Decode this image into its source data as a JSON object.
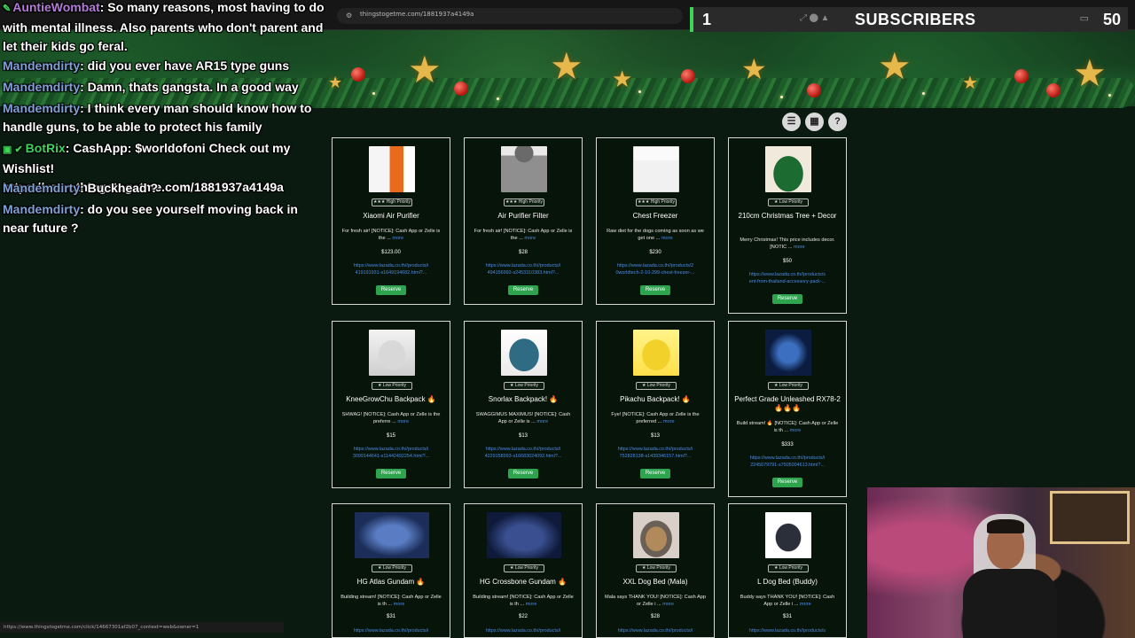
{
  "browser": {
    "url": "thingstogetme.com/1881937a4149a",
    "status_url": "https://www.thingstogetme.com/click/14667301af2b07_context=web&owner=1"
  },
  "subscribers": {
    "count": "1",
    "label": "SUBSCRIBERS",
    "goal": "50"
  },
  "chat": [
    {
      "user": "AuntieWombat",
      "text": ": So many reasons, most having to do",
      "cont": "with mental illness. Also parents who don't parent and let their kids go feral."
    },
    {
      "user": "Mandemdirty",
      "text": ": did you ever have AR15 type guns"
    },
    {
      "user": "Mandemdirty",
      "text": ": Damn, thats gangsta. In a good way"
    },
    {
      "user": "Mandemdirty",
      "text": ": I think every man should know how to handle guns, to be able to protect his family"
    },
    {
      "user": "BotRix",
      "text": ": CashApp: $worldofoni Check out my Wishlist! https://www.thingstogetme.com/1881937a4149a"
    },
    {
      "user": "Mandemdirty",
      "text": ": Buckhead ?"
    },
    {
      "user": "Mandemdirty",
      "text": ": do you see yourself moving back in near future ?"
    }
  ],
  "view_buttons": {
    "list_icon": "list-icon",
    "grid_icon": "grid-icon",
    "help_icon": "help-icon"
  },
  "cards": [
    {
      "title": "Xiaomi Air Purifier",
      "priority": "★★★ High Priority",
      "desc": "For fresh air! [NOTICE]: Cash App or Zelle is the ...",
      "more": "more",
      "price": "$123.00",
      "link": "https://www.lazada.co.th//products/i",
      "link2": "419191931-s1649194682.html?...",
      "button": "Reserve"
    },
    {
      "title": "Air Purifier Filter",
      "priority": "★★★ High Priority",
      "desc": "For fresh air! [NOTICE]: Cash App or Zelle is the ...",
      "more": "more",
      "price": "$28",
      "link": "https://www.lazada.co.th//products/i",
      "link2": "494156992-s2453310383.html?...",
      "button": "Reserve"
    },
    {
      "title": "Chest Freezer",
      "priority": "★★★ High Priority",
      "desc": "Raw diet for the dogs coming as soon as we get one ...",
      "more": "more",
      "price": "$230",
      "link": "https://www.lazada.co.th//products/2",
      "link2": "0worldtech-2-10-299-chest-freezer-...",
      "button": "Reserve"
    },
    {
      "title": "210cm Christmas Tree + Decor",
      "priority": "★ Low Priority",
      "desc": "Merry Christmas! This price includes decor. [NOTIC ...",
      "more": "more",
      "price": "$50",
      "link": "https://www.lazada.co.th//products/s",
      "link2": "ent-from-thailand-accessory-pack-...",
      "button": "Reserve"
    },
    {
      "title": "KneeGrowChu Backpack 🔥",
      "priority": "★ Low Priority",
      "desc": "SHWAG! [NOTICE]: Cash App or Zelle is the preferre ...",
      "more": "more",
      "price": "$15",
      "link": "https://www.lazada.co.th//products/i",
      "link2": "3099144641-s11442492254.html?...",
      "button": "Reserve"
    },
    {
      "title": "Snorlax Backpack! 🔥",
      "priority": "★ Low Priority",
      "desc": "SWAGGIMUS MAXIMUS! [NOTICE]: Cash App or Zelle is ...",
      "more": "more",
      "price": "$13",
      "link": "https://www.lazada.co.th//products/i",
      "link2": "4229158993-s16683024092.html?...",
      "button": "Reserve"
    },
    {
      "title": "Pikachu Backpack! 🔥",
      "priority": "★ Low Priority",
      "desc": "Fye! [NOTICE]: Cash App or Zelle is the preferred ...",
      "more": "more",
      "price": "$13",
      "link": "https://www.lazada.co.th//products/i",
      "link2": "752828138-s1439346157.html?...",
      "button": "Reserve"
    },
    {
      "title": "Perfect Grade Unleashed RX78-2 🔥🔥🔥",
      "priority": "★ Low Priority",
      "desc": "Build stream! 🔥 [NOTICE]: Cash App or Zelle is th ...",
      "more": "more",
      "price": "$333",
      "link": "https://www.lazada.co.th//products/i",
      "link2": "2245679791-s7505004613.html?...",
      "button": "Reserve"
    },
    {
      "title": "HG Atlas Gundam 🔥",
      "priority": "★ Low Priority",
      "desc": "Building stream! [NOTICE]: Cash App or Zelle is th ...",
      "more": "more",
      "price": "$31",
      "link": "https://www.lazada.co.th//products/i",
      "link2": "",
      "button": ""
    },
    {
      "title": "HG Crossbone Gundam 🔥",
      "priority": "★ Low Priority",
      "desc": "Building stream! [NOTICE]: Cash App or Zelle is th ...",
      "more": "more",
      "price": "$22",
      "link": "https://www.lazada.co.th//products/i",
      "link2": "",
      "button": ""
    },
    {
      "title": "XXL Dog Bed (Mala)",
      "priority": "★ Low Priority",
      "desc": "Mala says THANK YOU! [NOTICE]: Cash App or Zelle i ...",
      "more": "more",
      "price": "$28",
      "link": "https://www.lazada.co.th//products/i",
      "link2": "",
      "button": ""
    },
    {
      "title": "L Dog Bed (Buddy)",
      "priority": "★ Low Priority",
      "desc": "Buddy says THANK YOU! [NOTICE]: Cash App or Zelle i ...",
      "more": "more",
      "price": "$31",
      "link": "https://www.lazada.co.th//products/s",
      "link2": "",
      "button": ""
    }
  ]
}
